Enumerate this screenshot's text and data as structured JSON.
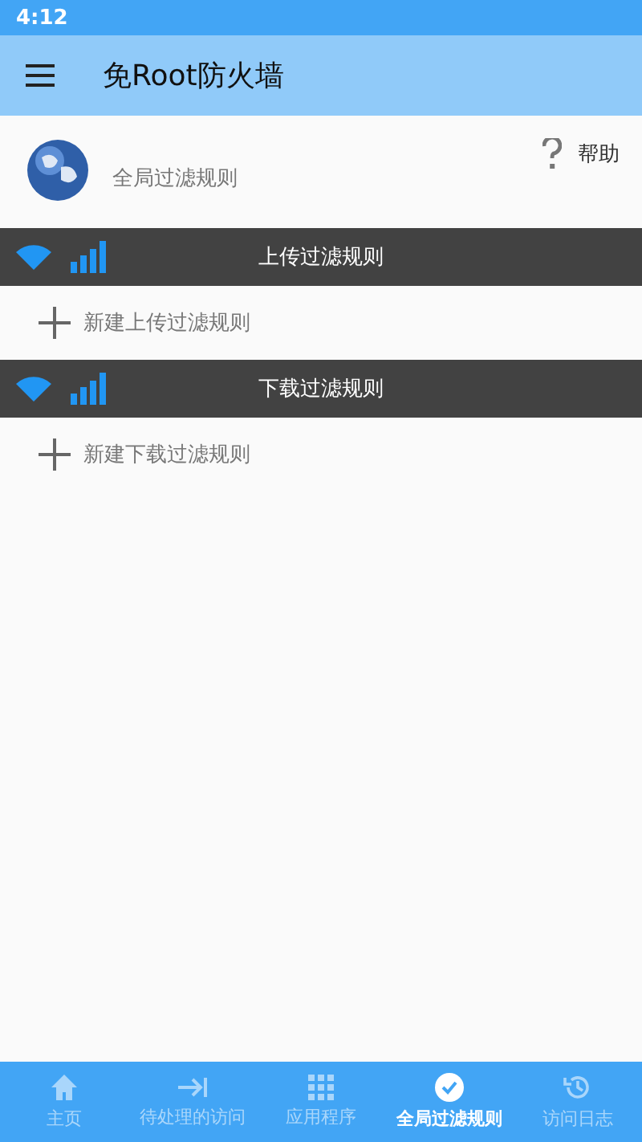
{
  "status_bar": {
    "time": "4:12"
  },
  "app_bar": {
    "title": "免Root防火墙"
  },
  "header": {
    "label": "全局过滤规则",
    "help": "帮助"
  },
  "sections": [
    {
      "title": "上传过滤规则",
      "add_label": "新建上传过滤规则"
    },
    {
      "title": "下载过滤规则",
      "add_label": "新建下载过滤规则"
    }
  ],
  "bottom_nav": [
    {
      "kind": "home",
      "label": "主页",
      "selected": false
    },
    {
      "kind": "pending",
      "label": "待处理的访问",
      "selected": false
    },
    {
      "kind": "apps",
      "label": "应用程序",
      "selected": false
    },
    {
      "kind": "global",
      "label": "全局过滤规则",
      "selected": true
    },
    {
      "kind": "log",
      "label": "访问日志",
      "selected": false
    }
  ]
}
